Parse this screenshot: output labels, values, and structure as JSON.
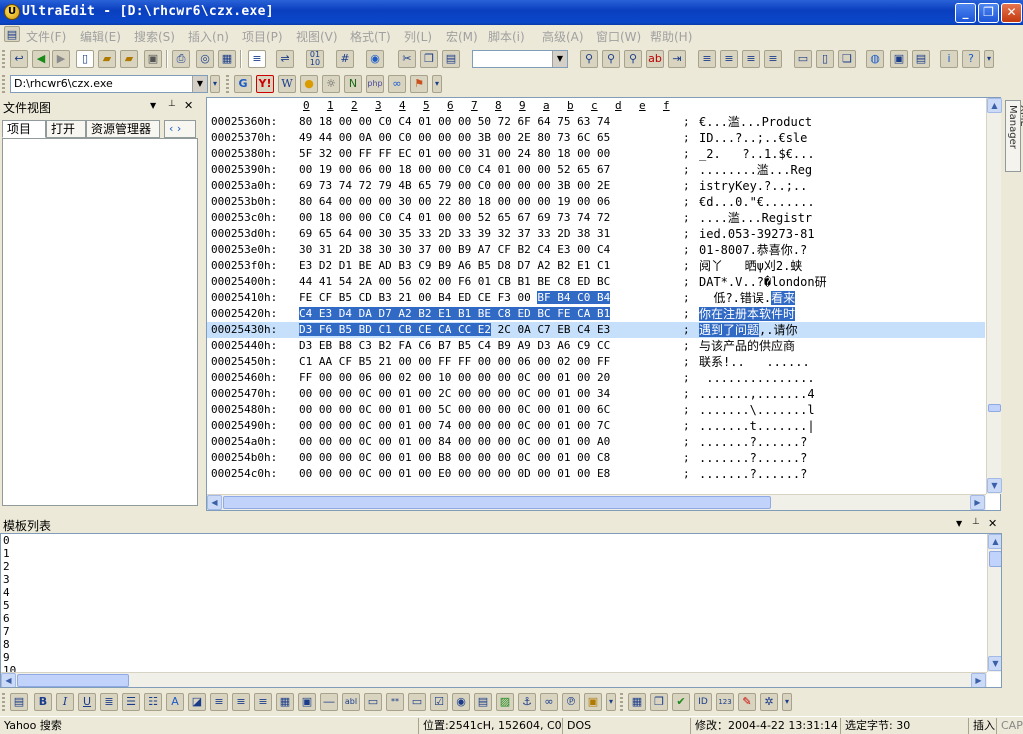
{
  "window": {
    "title": "UltraEdit - [D:\\rhcwr6\\czx.exe]",
    "min_label": "_",
    "restore_label": "❐",
    "close_label": "✕"
  },
  "menu": [
    "文件(F)",
    "编辑(E)",
    "搜索(S)",
    "插入(n)",
    "项目(P)",
    "视图(V)",
    "格式(T)",
    "列(L)",
    "宏(M)",
    "脚本(i)",
    "高级(A)",
    "窗口(W)",
    "帮助(H)"
  ],
  "toolbar2": {
    "path_combo": "D:\\rhcwr6\\czx.exe"
  },
  "file_view": {
    "title": "文件视图",
    "pin": "📌",
    "close": "✕",
    "tabs": [
      "项目",
      "打开",
      "资源管理器"
    ],
    "arrows": "‹ ›"
  },
  "editor": {
    "ruler": [
      "0",
      "1",
      "2",
      "3",
      "4",
      "5",
      "6",
      "7",
      "8",
      "9",
      "a",
      "b",
      "c",
      "d",
      "e",
      "f"
    ],
    "rows": [
      {
        "addr": "00025360h:",
        "hex": "80 18 00 00 C0 C4 01 00 00 50 72 6F 64 75 63 74",
        "asc": "€...滥...Product"
      },
      {
        "addr": "00025370h:",
        "hex": "49 44 00 0A 00 C0 00 00 00 3B 00 2E 80 73 6C 65",
        "asc": "ID...?..;..€sle"
      },
      {
        "addr": "00025380h:",
        "hex": "5F 32 00 FF FF EC 01 00 00 31 00 24 80 18 00 00",
        "asc": "_2.   ?..1.$€..."
      },
      {
        "addr": "00025390h:",
        "hex": "00 19 00 06 00 18 00 00 C0 C4 01 00 00 52 65 67",
        "asc": "........滥...Reg"
      },
      {
        "addr": "000253a0h:",
        "hex": "69 73 74 72 79 4B 65 79 00 C0 00 00 00 3B 00 2E",
        "asc": "istryKey.?..;.."
      },
      {
        "addr": "000253b0h:",
        "hex": "80 64 00 00 00 30 00 22 80 18 00 00 00 19 00 06",
        "asc": "€d...0.\"€......."
      },
      {
        "addr": "000253c0h:",
        "hex": "00 18 00 00 C0 C4 01 00 00 52 65 67 69 73 74 72",
        "asc": "....滥...Registr"
      },
      {
        "addr": "000253d0h:",
        "hex": "69 65 64 00 30 35 33 2D 33 39 32 37 33 2D 38 31",
        "asc": "ied.053-39273-81"
      },
      {
        "addr": "000253e0h:",
        "hex": "30 31 2D 38 30 30 37 00 B9 A7 CF B2 C4 E3 00 C4",
        "asc": "01-8007.恭喜你.?"
      },
      {
        "addr": "000253f0h:",
        "hex": "E3 D2 D1 BE AD B3 C9 B9 A6 B5 D8 D7 A2 B2 E1 C1",
        "asc": "阋丫   晒ψ刈2.蛱"
      },
      {
        "addr": "00025400h:",
        "hex": "44 41 54 2A 00 56 02 00 F6 01 CB B1 BE C8 ED BC",
        "asc": "DAT*.V..?�london研"
      },
      {
        "addr": "00025410h:",
        "hex": "FE CF B5 CD B3 21 00 B4 ED CE F3 00 BF B4 C0 B4",
        "asc": "  低?.错误.看来"
      },
      {
        "addr": "00025420h:",
        "hex": "C4 E3 D4 DA D7 A2 B2 E1 B1 BE C8 ED BC FE CA B1",
        "asc": "你在注册本软件时"
      },
      {
        "addr": "00025430h:",
        "hex": "D3 F6 B5 BD C1 CB CE CA CC E2 2C 0A C7 EB C4 E3",
        "asc": "遇到了问题,.请你"
      },
      {
        "addr": "00025440h:",
        "hex": "D3 EB B8 C3 B2 FA C6 B7 B5 C4 B9 A9 D3 A6 C9 CC",
        "asc": "与该产品的供应商"
      },
      {
        "addr": "00025450h:",
        "hex": "C1 AA CF B5 21 00 00 FF FF 00 00 06 00 02 00 FF",
        "asc": "联系!..   ......"
      },
      {
        "addr": "00025460h:",
        "hex": "FF 00 00 06 00 02 00 10 00 00 00 0C 00 01 00 20",
        "asc": " ..............."
      },
      {
        "addr": "00025470h:",
        "hex": "00 00 00 0C 00 01 00 2C 00 00 00 0C 00 01 00 34",
        "asc": ".......,.......4"
      },
      {
        "addr": "00025480h:",
        "hex": "00 00 00 0C 00 01 00 5C 00 00 00 0C 00 01 00 6C",
        "asc": ".......\\.......l"
      },
      {
        "addr": "00025490h:",
        "hex": "00 00 00 0C 00 01 00 74 00 00 00 0C 00 01 00 7C",
        "asc": ".......t.......|"
      },
      {
        "addr": "000254a0h:",
        "hex": "00 00 00 0C 00 01 00 84 00 00 00 0C 00 01 00 A0",
        "asc": ".......?......?"
      },
      {
        "addr": "000254b0h:",
        "hex": "00 00 00 0C 00 01 00 B8 00 00 00 0C 00 01 00 C8",
        "asc": ".......?......?"
      },
      {
        "addr": "000254c0h:",
        "hex": "00 00 00 0C 00 01 00 E0 00 00 00 0D 00 01 00 E8",
        "asc": ".......?......?"
      }
    ]
  },
  "xml_manager_label": "XML Manager",
  "template_list": {
    "title": "模板列表",
    "pin": "📌",
    "close": "✕",
    "lines": [
      "0",
      "1",
      "2",
      "3",
      "4",
      "5",
      "6",
      "7",
      "8",
      "9",
      "10"
    ]
  },
  "status": {
    "left": "Yahoo 搜索",
    "position": "位置:2541cH, 152604, C0",
    "format": "DOS",
    "modified": "修改：2004-4-22 13:31:14",
    "selected": "选定字节: 30",
    "insert": "插入",
    "caps": "CAP"
  },
  "colors": {
    "selection": "#316ac5",
    "current_line": "#c6e0fb",
    "title_bar": "#0a3fbf"
  }
}
